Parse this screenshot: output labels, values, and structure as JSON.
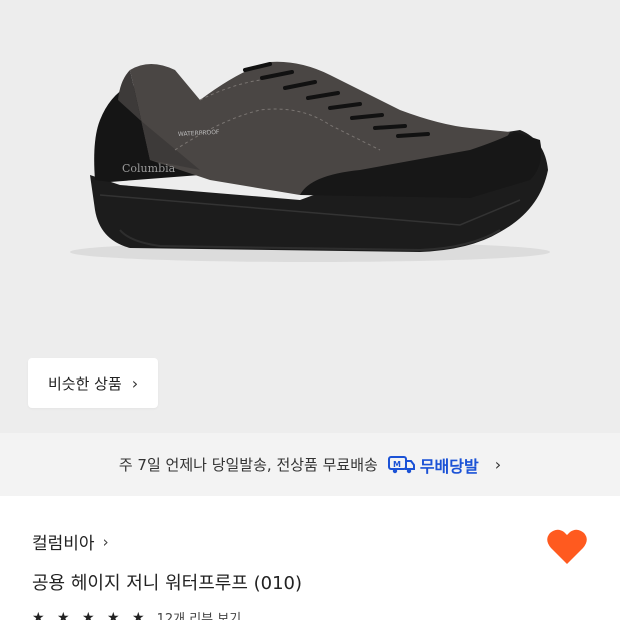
{
  "product": {
    "image_alt": "Columbia dark grey suede waterproof sneaker",
    "brand_print": "Columbia",
    "badge_print": "WATERPROOF"
  },
  "similar": {
    "label": "비슷한 상품"
  },
  "shipping": {
    "notice": "주 7일 언제나 당일발송, 전상품 무료배송",
    "badge_label": "무배당발"
  },
  "info": {
    "brand": "컬럼비아",
    "title": "공용 헤이지 저니 워터프루프 (010)",
    "review_text": "12개 리뷰 보기",
    "stars": "★ ★ ★ ★ ★"
  },
  "colors": {
    "heart": "#ff5a1f",
    "accent": "#1b52d6"
  }
}
